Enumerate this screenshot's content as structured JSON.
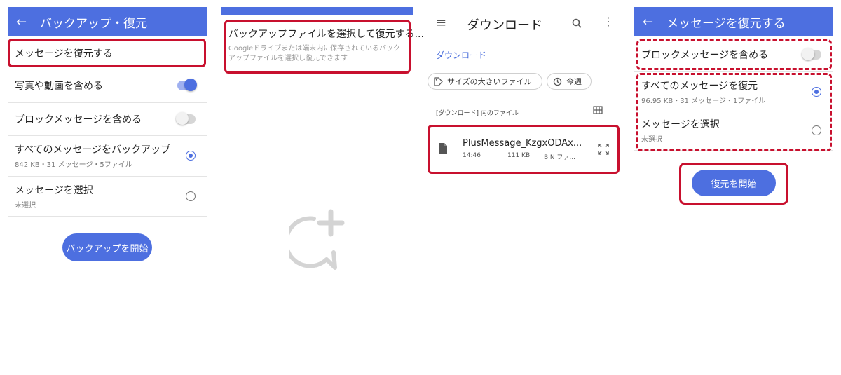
{
  "colors": {
    "accent": "#4d6fe0",
    "highlight": "#c8102e"
  },
  "panel1": {
    "title": "バックアップ・復元",
    "rows": [
      {
        "label": "メッセージを復元する"
      },
      {
        "label": "写真や動画を含める",
        "switch": "on"
      },
      {
        "label": "ブロックメッセージを含める",
        "switch": "off"
      },
      {
        "label": "すべてのメッセージをバックアップ",
        "sub": "842 KB・31 メッセージ・5ファイル",
        "radio": "on"
      },
      {
        "label": "メッセージを選択",
        "sub": "未選択",
        "radio": "off"
      }
    ],
    "button": "バックアップを開始"
  },
  "panel2": {
    "title": "バックアップファイルを選択して復元する...",
    "desc": "Googleドライブまたは端末内に保存されているバックアップファイルを選択し復元できます",
    "placeholder_icon": "chat-plus-icon"
  },
  "panel3": {
    "title": "ダウンロード",
    "breadcrumb": "ダウンロード",
    "chips": [
      "サイズの大きいファイル",
      "今週"
    ],
    "section": "[ダウンロード] 内のファイル",
    "file": {
      "name": "PlusMessage_KzgxODAx...",
      "time": "14:46",
      "size": "111 KB",
      "type": "BIN ファ..."
    }
  },
  "panel4": {
    "title": "メッセージを復元する",
    "rows": [
      {
        "label": "ブロックメッセージを含める",
        "switch": "off"
      },
      {
        "label": "すべてのメッセージを復元",
        "sub": "96.95 KB・31 メッセージ・1ファイル",
        "radio": "on"
      },
      {
        "label": "メッセージを選択",
        "sub": "未選択",
        "radio": "off"
      }
    ],
    "button": "復元を開始"
  }
}
